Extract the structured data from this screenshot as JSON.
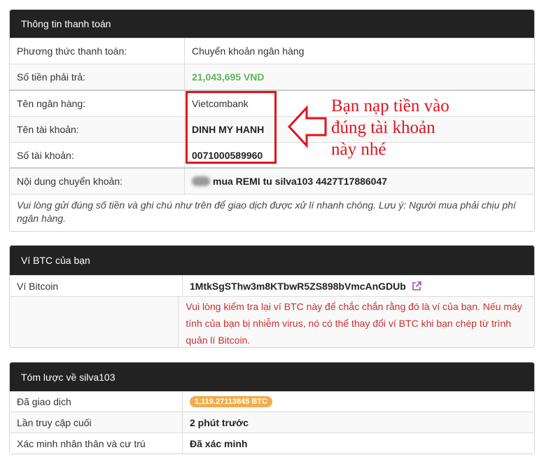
{
  "payment": {
    "title": "Thông tin thanh toán",
    "method_label": "Phương thức thanh toán:",
    "method_value": "Chuyển khoản ngân hàng",
    "amount_label": "Số tiền phải trả:",
    "amount_value": "21,043,695 VND",
    "bank_label": "Tên ngân hàng:",
    "bank_value": "Vietcombank",
    "account_name_label": "Tên tài khoản:",
    "account_name_value": "DINH MY HANH",
    "account_number_label": "Số tài khoản:",
    "account_number_value": "0071000589960",
    "content_label": "Nội dung chuyển khoản:",
    "content_value": "mua REMI tu silva103 4427T17886047",
    "note": "Vui lòng gửi đúng số tiền và ghi chú như trên để giao dịch được xử lí nhanh chóng. Lưu ý: Người mua phải chịu phí ngân hàng."
  },
  "annotation": {
    "line1": "Bạn nạp tiền vào",
    "line2": "đúng tài khoản",
    "line3": "này nhé",
    "color": "#e0141e"
  },
  "wallet": {
    "title": "Ví BTC của bạn",
    "label": "Ví Bitcoin",
    "address": "1MtkSgSThw3m8KTbwR5ZS898bVmcAnGDUb",
    "warning": "Vui lòng kiểm tra lại ví BTC này để chắc chắn rằng đó là ví của bạn. Nếu máy tính của bạn bị nhiễm virus, nó có thể thay đổi ví BTC khi bạn chép từ trình quản lí Bitcoin."
  },
  "summary": {
    "title": "Tóm lược về silva103",
    "traded_label": "Đã giao dịch",
    "traded_value": "1,119.27113845 BTC",
    "last_seen_label": "Lần truy cập cuối",
    "last_seen_value": "2 phút trước",
    "verify_label": "Xác minh nhân thân và cư trú",
    "verify_value": "Đã xác minh"
  },
  "colors": {
    "header_bg": "#222222",
    "amount_green": "#5cb85c",
    "badge_orange": "#f0ad4e",
    "warning_red": "#c9302c"
  }
}
